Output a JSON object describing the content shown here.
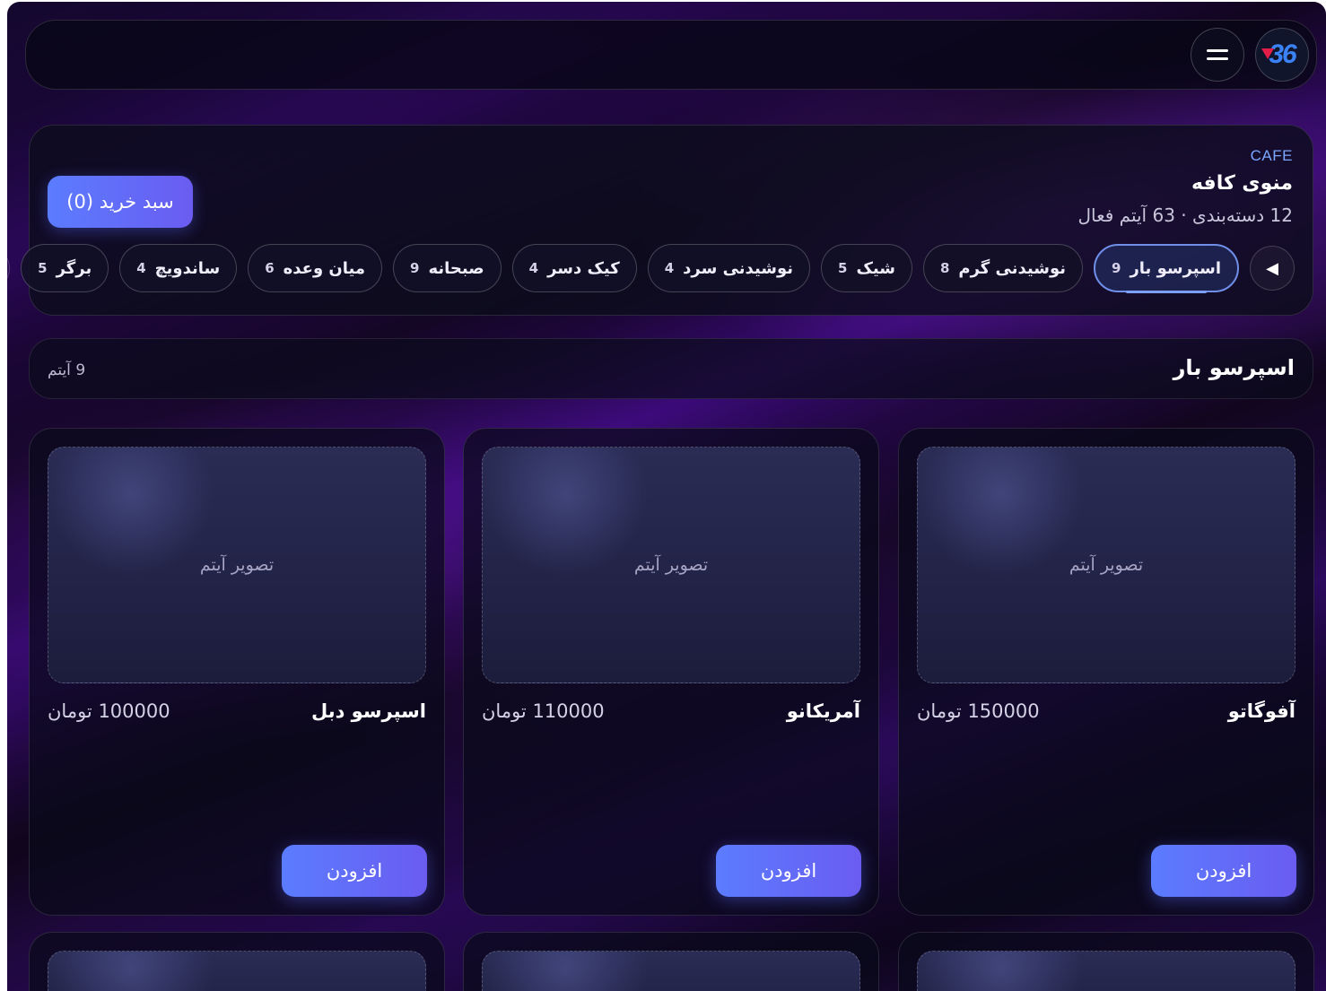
{
  "header": {
    "logo_text": "36",
    "eyebrow": "CAFE",
    "title": "منوی کافه",
    "subtitle": "12 دسته‌بندی · 63 آیتم فعال",
    "cart_label": "سبد خرید (0)"
  },
  "tabs": [
    {
      "label": "اسپرسو بار",
      "count": "9",
      "active": true
    },
    {
      "label": "نوشیدنی گرم",
      "count": "8"
    },
    {
      "label": "شیک",
      "count": "5"
    },
    {
      "label": "نوشیدنی سرد",
      "count": "4"
    },
    {
      "label": "کیک دسر",
      "count": "4"
    },
    {
      "label": "صبحانه",
      "count": "9"
    },
    {
      "label": "میان وعده",
      "count": "6"
    },
    {
      "label": "ساندویچ",
      "count": "4"
    },
    {
      "label": "برگر",
      "count": "5"
    }
  ],
  "section": {
    "title": "اسپرسو بار",
    "count_label": "9 آیتم"
  },
  "items": [
    {
      "name": "آفوگاتو",
      "price": "150000 تومان",
      "image_label": "تصویر آیتم",
      "add_label": "افزودن"
    },
    {
      "name": "آمریکانو",
      "price": "110000 تومان",
      "image_label": "تصویر آیتم",
      "add_label": "افزودن"
    },
    {
      "name": "اسپرسو دبل",
      "price": "100000 تومان",
      "image_label": "تصویر آیتم",
      "add_label": "افزودن"
    }
  ],
  "icons": {
    "menu": "hamburger-icon",
    "prev": "arrow-left-icon",
    "next": "arrow-right-icon"
  },
  "colors": {
    "accent": "#5b7cff",
    "active_tab_border": "#6f8fe8",
    "eyebrow": "#7aa6ff"
  }
}
